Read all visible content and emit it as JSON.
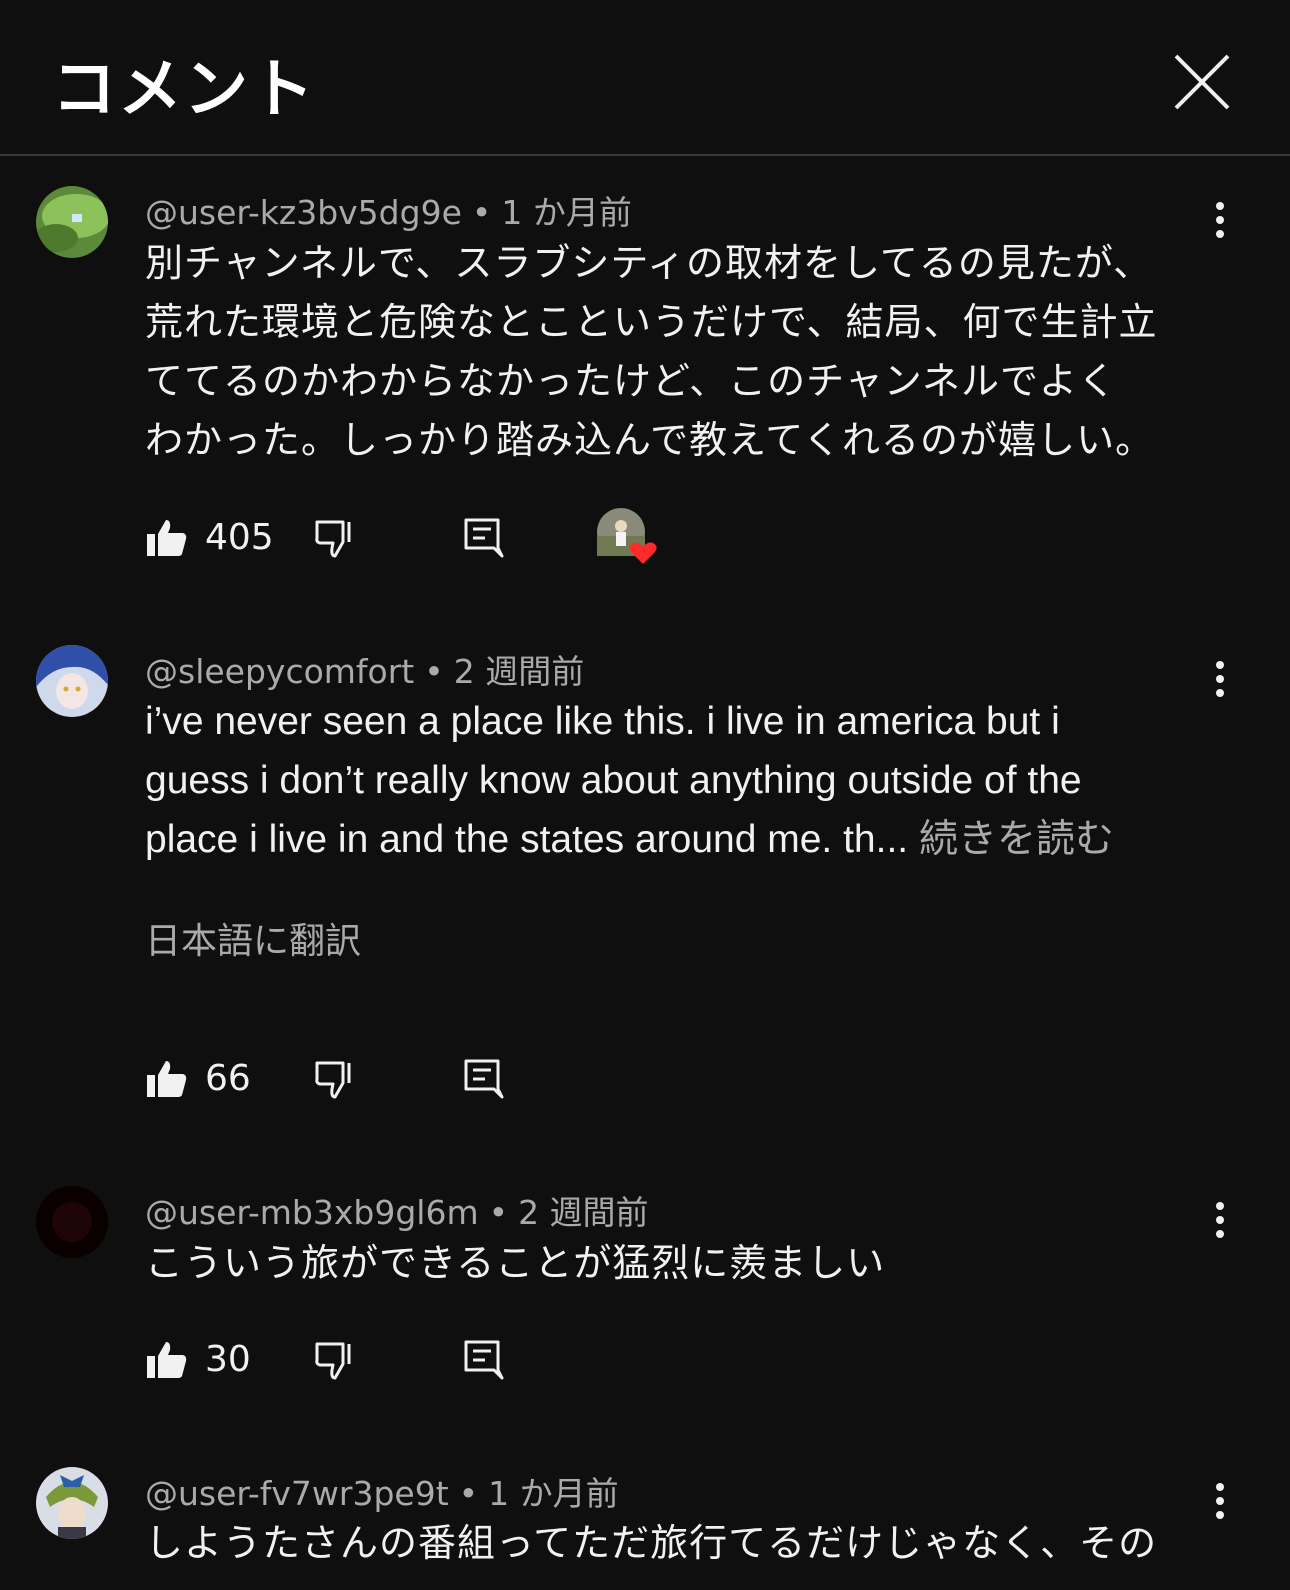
{
  "header": {
    "title": "コメント",
    "close_icon": "close-icon"
  },
  "comments": [
    {
      "author": "@user-kz3bv5dg9e",
      "time": "1 か月前",
      "lines": [
        "別チャンネルで、スラブシティの取材をしてるの見たが、",
        "荒れた環境と危険なとこというだけで、結局、何で生計立",
        "ててるのかわからなかったけど、このチャンネルでよく",
        "わかった。しっかり踏み込んで教えてくれるのが嬉しい。"
      ],
      "likes": "405",
      "creator_heart": true
    },
    {
      "author": "@sleepycomfort",
      "time": "2 週間前",
      "lines": [
        "i’ve never seen a place like this. i live in america but i",
        "guess i don’t really know about anything outside of the",
        "place i live in and the states around me. th..."
      ],
      "read_more": "続きを読む",
      "translate": "日本語に翻訳",
      "likes": "66"
    },
    {
      "author": "@user-mb3xb9gl6m",
      "time": "2 週間前",
      "lines": [
        "こういう旅ができることが猛烈に羨ましい"
      ],
      "likes": "30"
    },
    {
      "author": "@user-fv7wr3pe9t",
      "time": "1 か月前",
      "lines": [
        "しようたさんの番組ってただ旅行てるだけじゃなく、その"
      ]
    }
  ],
  "colors": {
    "background": "#0f0f0f",
    "secondary_text": "#aaaaaa",
    "heart": "#ff2b2b"
  }
}
